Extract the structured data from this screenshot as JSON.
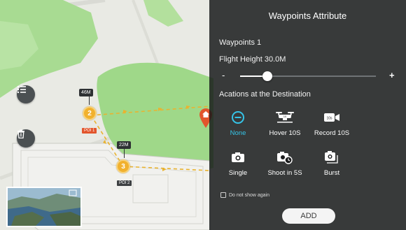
{
  "map": {
    "markers": [
      {
        "number": "2",
        "altitude": "46M",
        "poi": "POI 1"
      },
      {
        "number": "3",
        "altitude": "22M",
        "poi": "POI 2"
      }
    ],
    "icons": {
      "list": "list-icon",
      "delete": "trash-icon",
      "home": "home-pin-icon"
    },
    "colors": {
      "park": "#9fd889",
      "marker": "#f1b12e",
      "poi_active": "#e2552c"
    }
  },
  "panel": {
    "title": "Waypoints Attribute",
    "waypoint_name": "Waypoints 1",
    "flight_height_label": "Flight Height",
    "flight_height_value": "30.0M",
    "slider": {
      "minus": "-",
      "plus": "+",
      "fraction": 0.2
    },
    "actions_title": "Acations at the Destination",
    "actions": [
      {
        "label": "None",
        "icon": "none-circle-icon",
        "selected": true
      },
      {
        "label": "Hover 10S",
        "icon": "drone-hover-icon",
        "selected": false
      },
      {
        "label": "Record 10S",
        "icon": "video-record-icon",
        "selected": false
      },
      {
        "label": "Single",
        "icon": "camera-icon",
        "selected": false
      },
      {
        "label": "Shoot in 5S",
        "icon": "camera-timer-icon",
        "selected": false
      },
      {
        "label": "Burst",
        "icon": "camera-burst-icon",
        "selected": false
      }
    ],
    "accent_color": "#35c4e8",
    "checkbox_label": "Do not show again",
    "add_label": "ADD"
  }
}
